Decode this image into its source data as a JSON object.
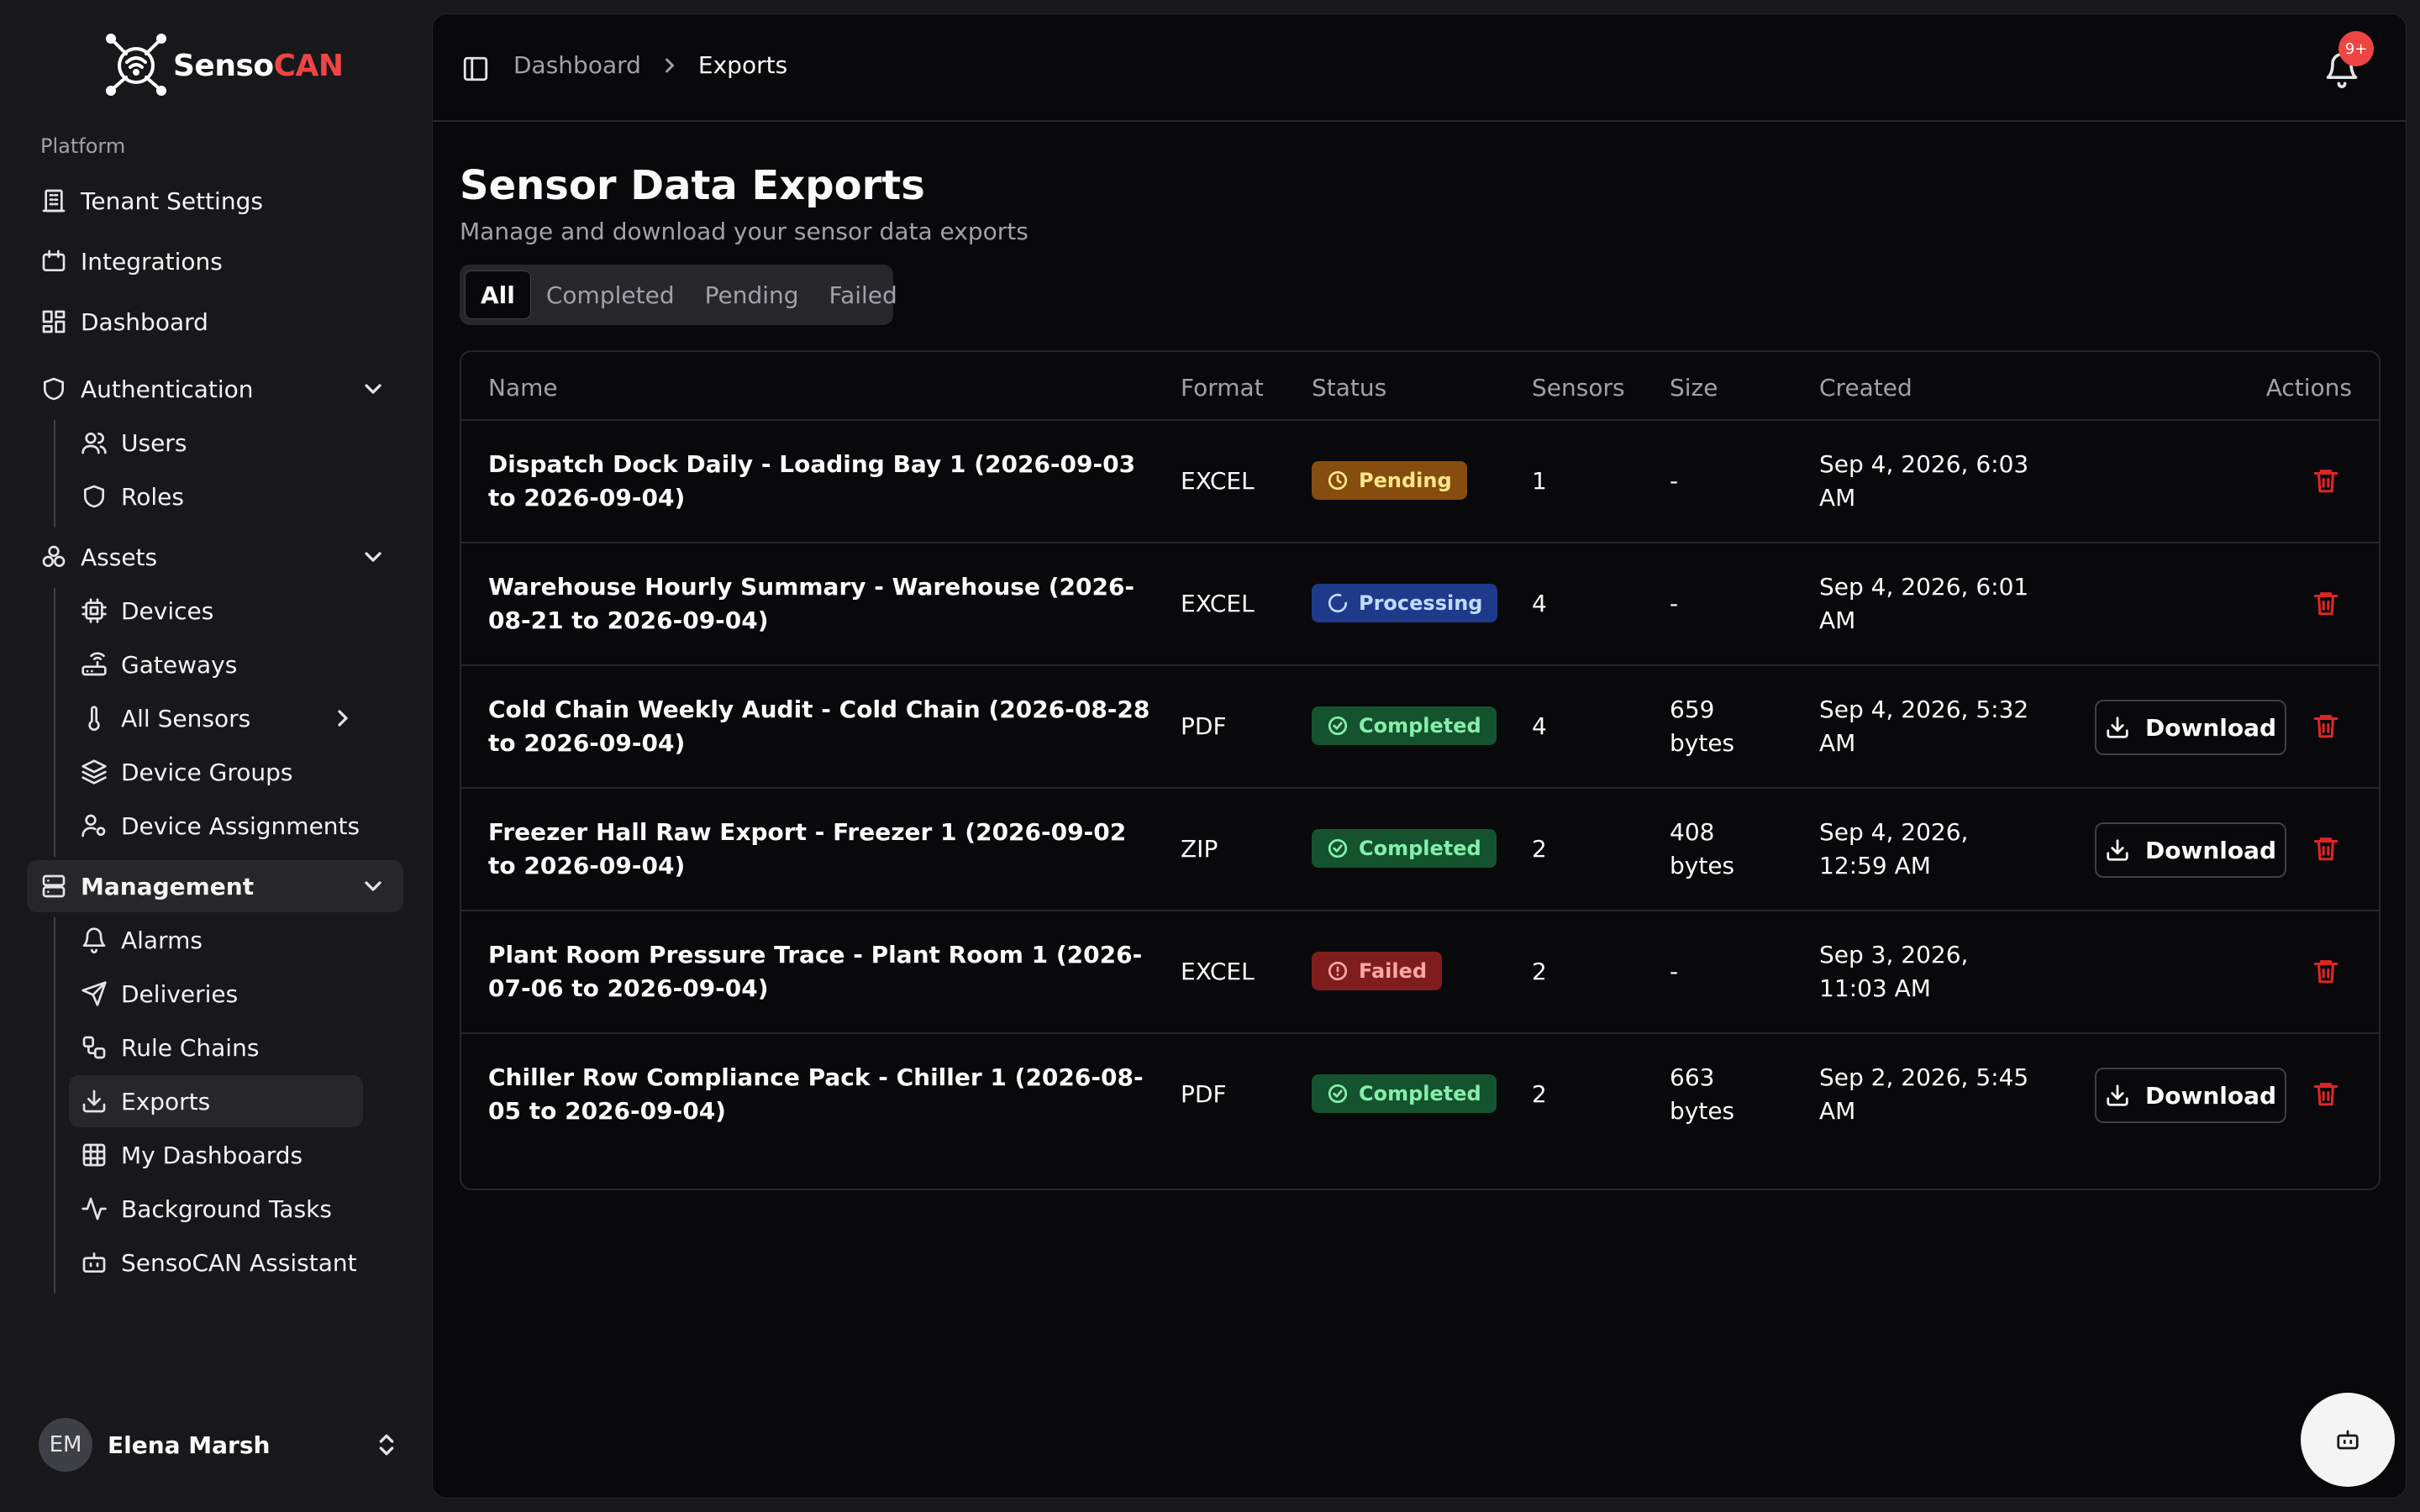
{
  "brand": {
    "name_part1": "Senso",
    "name_part2": "CAN"
  },
  "sidebar": {
    "group_label": "Platform",
    "items": {
      "tenant_settings": "Tenant Settings",
      "integrations": "Integrations",
      "dashboard": "Dashboard",
      "authentication": "Authentication",
      "users": "Users",
      "roles": "Roles",
      "assets": "Assets",
      "devices": "Devices",
      "gateways": "Gateways",
      "all_sensors": "All Sensors",
      "device_groups": "Device Groups",
      "device_assignments": "Device Assignments",
      "management": "Management",
      "alarms": "Alarms",
      "deliveries": "Deliveries",
      "rule_chains": "Rule Chains",
      "exports": "Exports",
      "my_dashboards": "My Dashboards",
      "background_tasks": "Background Tasks",
      "assistant": "SensoCAN Assistant"
    },
    "user": {
      "initials": "EM",
      "name": "Elena Marsh"
    }
  },
  "header": {
    "breadcrumb_parent": "Dashboard",
    "breadcrumb_current": "Exports",
    "notification_count": "9+"
  },
  "page": {
    "title": "Sensor Data Exports",
    "subtitle": "Manage and download your sensor data exports"
  },
  "tabs": [
    "All",
    "Completed",
    "Pending",
    "Failed"
  ],
  "table": {
    "columns": {
      "name": "Name",
      "format": "Format",
      "status": "Status",
      "sensors": "Sensors",
      "size": "Size",
      "created": "Created",
      "actions": "Actions"
    },
    "download_label": "Download",
    "rows": [
      {
        "name": "Dispatch Dock Daily - Loading Bay 1 (2026-09-03 to 2026-09-04)",
        "format": "EXCEL",
        "status": "Pending",
        "sensors": "1",
        "size": "-",
        "created": "Sep 4, 2026, 6:03 AM"
      },
      {
        "name": "Warehouse Hourly Summary - Warehouse (2026-08-21 to 2026-09-04)",
        "format": "EXCEL",
        "status": "Processing",
        "sensors": "4",
        "size": "-",
        "created": "Sep 4, 2026, 6:01 AM"
      },
      {
        "name": "Cold Chain Weekly Audit - Cold Chain (2026-08-28 to 2026-09-04)",
        "format": "PDF",
        "status": "Completed",
        "sensors": "4",
        "size": "659 bytes",
        "created": "Sep 4, 2026, 5:32 AM"
      },
      {
        "name": "Freezer Hall Raw Export - Freezer 1 (2026-09-02 to 2026-09-04)",
        "format": "ZIP",
        "status": "Completed",
        "sensors": "2",
        "size": "408 bytes",
        "created": "Sep 4, 2026, 12:59 AM"
      },
      {
        "name": "Plant Room Pressure Trace - Plant Room 1 (2026-07-06 to 2026-09-04)",
        "format": "EXCEL",
        "status": "Failed",
        "sensors": "2",
        "size": "-",
        "created": "Sep 3, 2026, 11:03 AM"
      },
      {
        "name": "Chiller Row Compliance Pack - Chiller 1 (2026-08-05 to 2026-09-04)",
        "format": "PDF",
        "status": "Completed",
        "sensors": "2",
        "size": "663 bytes",
        "created": "Sep 2, 2026, 5:45 AM"
      }
    ]
  },
  "colors": {
    "brand_red": "#ef4444",
    "delete_red": "#dc2626",
    "pending": "#854d0e",
    "processing": "#1e3a8a",
    "completed": "#14532d",
    "failed": "#7f1d1d"
  }
}
